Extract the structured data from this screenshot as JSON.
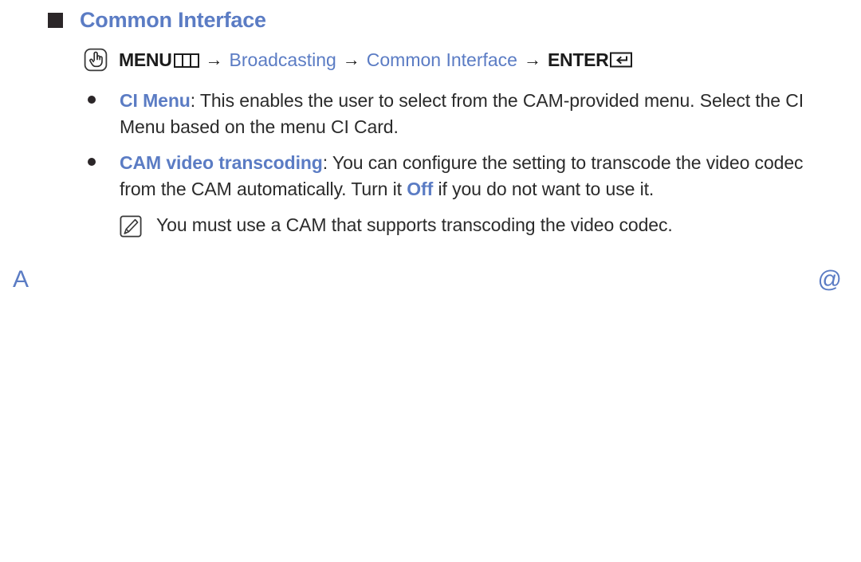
{
  "page": {
    "heading": "Common Interface",
    "heading_color": "#5b7cc4",
    "text_color": "#2b2b2b",
    "background": "#ffffff"
  },
  "menu_path": {
    "touch_icon": "touch-hand-icon",
    "menu_label": "MENU",
    "menu_glyph": "menu-button-icon",
    "arrow1": "→",
    "step1": "Broadcasting",
    "arrow2": "→",
    "step2": "Common Interface",
    "arrow3": "→",
    "enter_label": "ENTER",
    "enter_glyph": "enter-return-icon"
  },
  "bullets": [
    {
      "term": "CI Menu",
      "separator": ":",
      "description": " This enables the user to select from the CAM-provided menu. Select the CI Menu based on the menu CI Card."
    },
    {
      "term": "CAM video transcoding",
      "separator": ":",
      "desc_before": " You can configure the setting to transcode the video codec from the CAM automatically. Turn it ",
      "highlight": "Off",
      "desc_after": " if you do not want to use it."
    }
  ],
  "note": {
    "icon": "note-pencil-icon",
    "text": "You must use a CAM that supports transcoding the video codec."
  },
  "footer": {
    "left_mark": "A",
    "right_mark": "@"
  }
}
